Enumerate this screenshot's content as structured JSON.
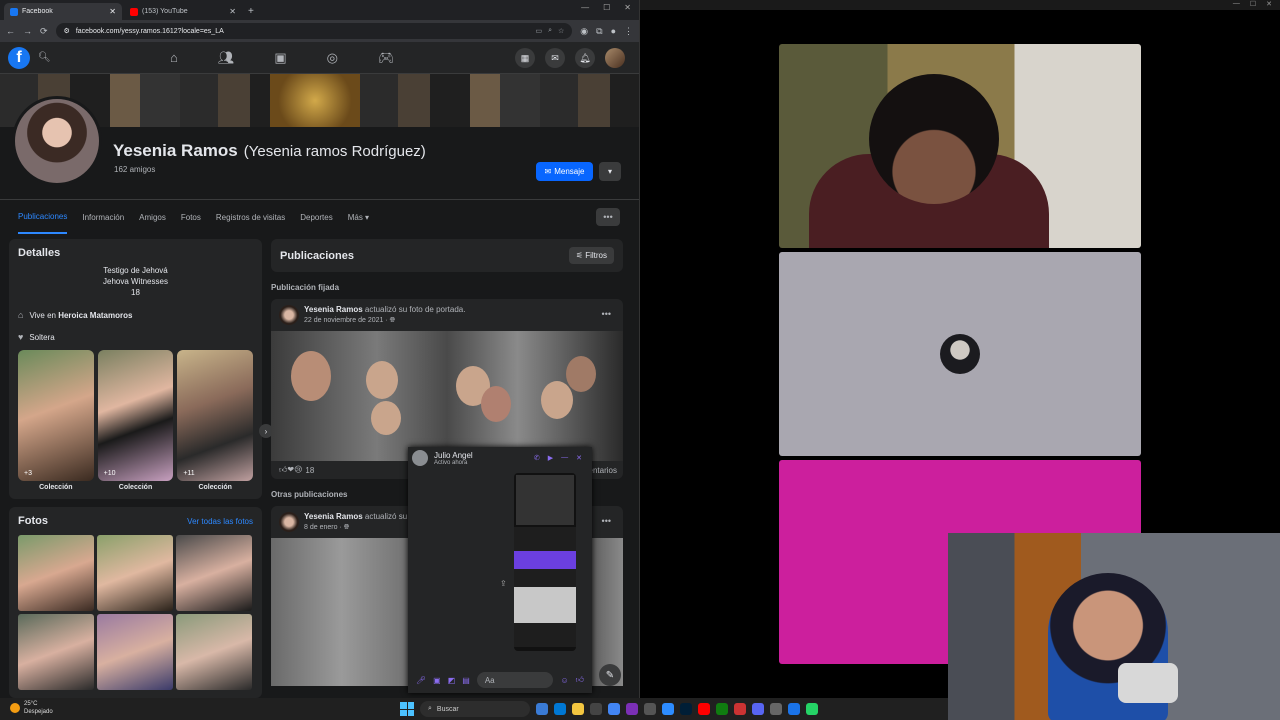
{
  "browser": {
    "tabs": [
      {
        "label": "Facebook",
        "active": true,
        "color": "#1877f2"
      },
      {
        "label": "(153) YouTube",
        "active": false,
        "color": "#ff0000"
      }
    ],
    "url": "facebook.com/yessy.ramos.1612?locale=es_LA"
  },
  "fb": {
    "logo": "f",
    "profile": {
      "name": "Yesenia Ramos",
      "alt_name": "(Yesenia ramos Rodríguez)",
      "friends": "162 amigos",
      "message_btn": "Mensaje"
    },
    "tabs": [
      "Publicaciones",
      "Información",
      "Amigos",
      "Fotos",
      "Registros de visitas",
      "Deportes",
      "Más"
    ],
    "details": {
      "title": "Detalles",
      "bio": [
        "Testigo de Jehová",
        "Jehova Witnesses",
        "18"
      ],
      "lives_prefix": "Vive en ",
      "lives_city": "Heroica Matamoros",
      "status": "Soltera",
      "collections": [
        {
          "label": "Colección",
          "count": "+3"
        },
        {
          "label": "Colección",
          "count": "+10"
        },
        {
          "label": "Colección",
          "count": "+11"
        }
      ]
    },
    "photos": {
      "title": "Fotos",
      "see_all": "Ver todas las fotos"
    },
    "posts": {
      "title": "Publicaciones",
      "filters": "Filtros",
      "pinned_label": "Publicación fijada",
      "pinned": {
        "author": "Yesenia Ramos",
        "action": " actualizó su foto de portada.",
        "date": "22 de noviembre de 2021 · ",
        "reactions": "18",
        "comments": "entarios"
      },
      "other_label": "Otras publicaciones",
      "other": {
        "author": "Yesenia Ramos",
        "action": " actualizó su",
        "date": "8 de enero · "
      }
    },
    "chat": {
      "name": "Julio Angel",
      "status": "Activo ahora",
      "input_placeholder": "Aa"
    }
  },
  "taskbar": {
    "temp": "25°C",
    "weather": "Despejado",
    "search": "Buscar"
  }
}
